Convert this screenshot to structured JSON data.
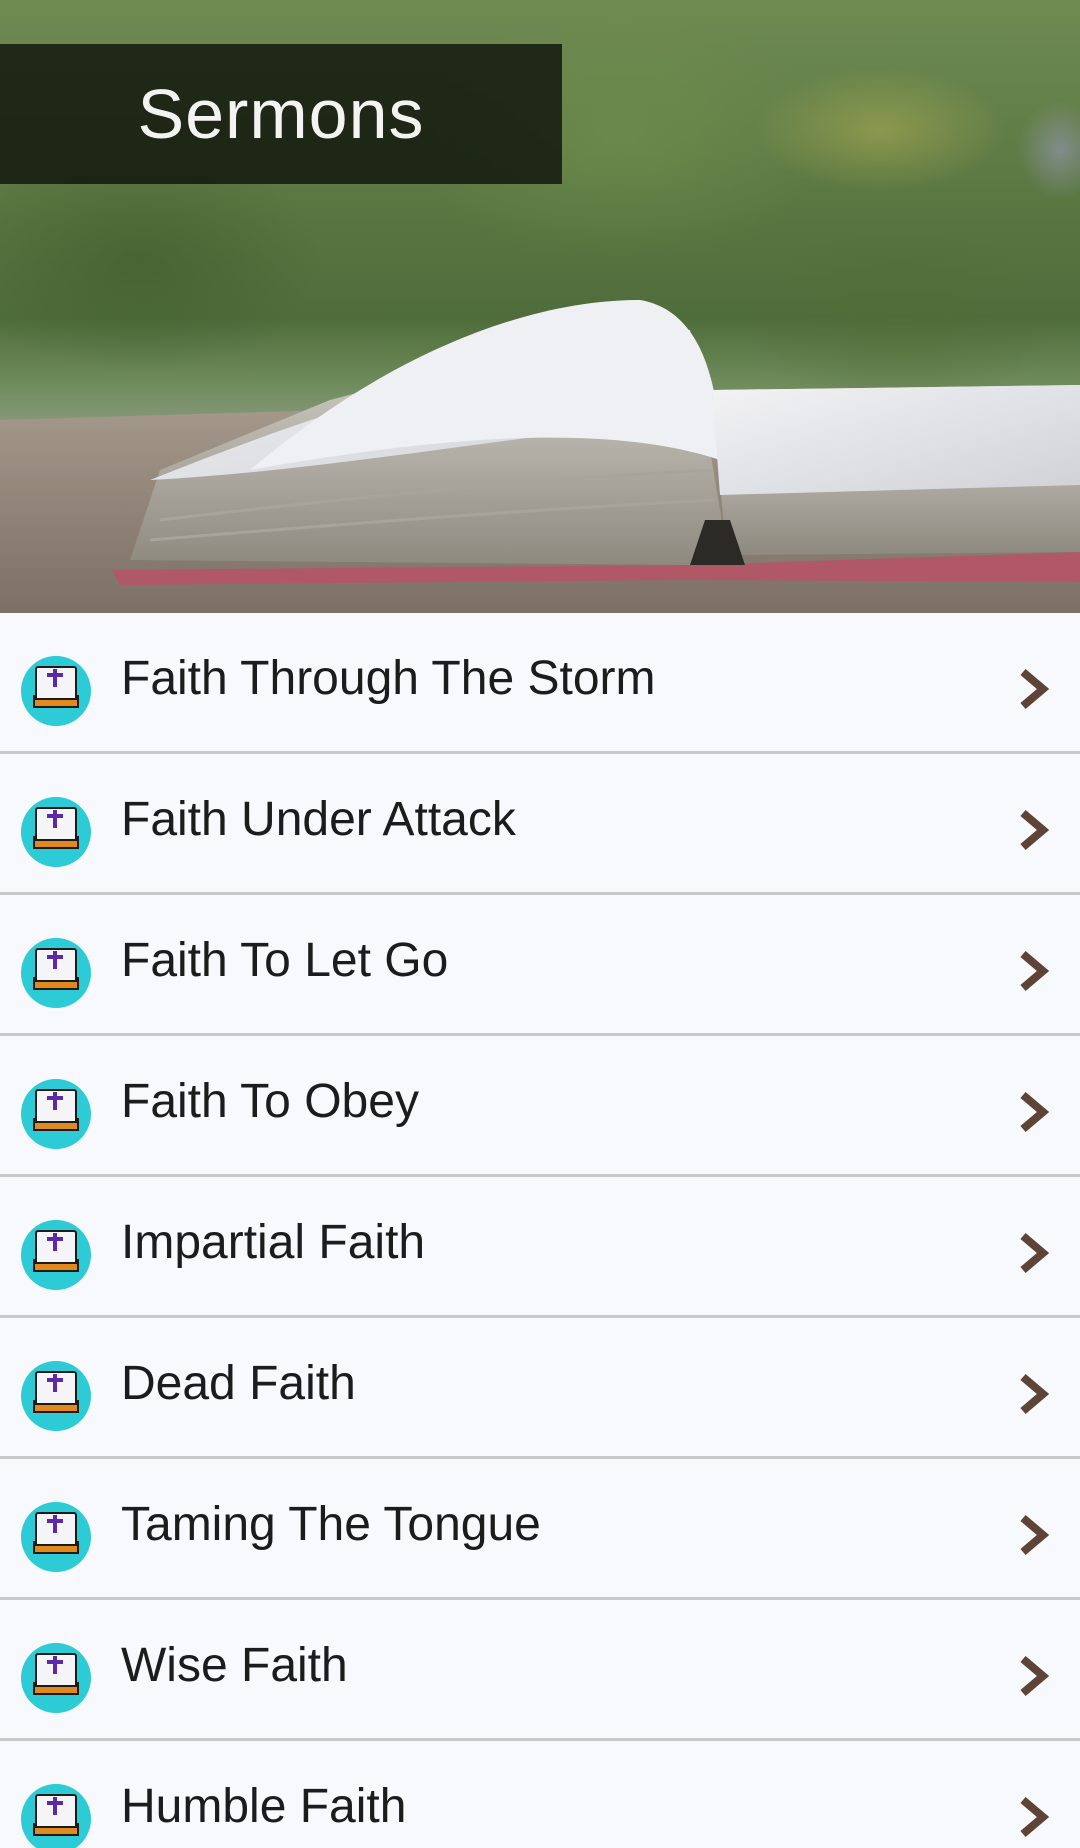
{
  "header": {
    "title": "Sermons"
  },
  "items": [
    {
      "label": "Faith Through The Storm"
    },
    {
      "label": "Faith Under Attack"
    },
    {
      "label": "Faith To Let Go"
    },
    {
      "label": "Faith To Obey"
    },
    {
      "label": "Impartial Faith"
    },
    {
      "label": "Dead Faith"
    },
    {
      "label": "Taming The Tongue"
    },
    {
      "label": "Wise Faith"
    },
    {
      "label": "Humble Faith"
    }
  ],
  "icons": {
    "row_icon": "bible-icon",
    "row_arrow": "chevron-right-icon"
  },
  "colors": {
    "icon_circle": "#2ccbd6",
    "icon_cross": "#5b2aa8",
    "book_cover": "#e08a1e",
    "chevron": "#5e4436",
    "divider": "#c9c9c9",
    "background": "#f8f9fd"
  }
}
